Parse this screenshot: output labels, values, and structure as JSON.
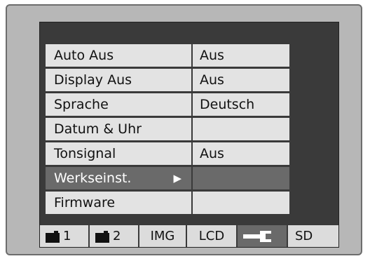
{
  "menu": {
    "items": [
      {
        "label": "Auto Aus",
        "value": "Aus"
      },
      {
        "label": "Display Aus",
        "value": "Aus"
      },
      {
        "label": "Sprache",
        "value": "Deutsch"
      },
      {
        "label": "Datum & Uhr",
        "value": ""
      },
      {
        "label": "Tonsignal",
        "value": "Aus"
      },
      {
        "label": "Werkseinst.",
        "value": "",
        "selected": true,
        "submenu_arrow": "▶"
      },
      {
        "label": "Firmware",
        "value": ""
      }
    ]
  },
  "tabs": [
    {
      "icon": "camera-icon",
      "label": "1"
    },
    {
      "icon": "camera-icon",
      "label": "2"
    },
    {
      "label": "IMG"
    },
    {
      "label": "LCD"
    },
    {
      "icon": "wrench-icon",
      "label": "",
      "active": true
    },
    {
      "label": "SD"
    }
  ],
  "colors": {
    "screen_background": "#3a3a3a",
    "menu_cell": "#e3e3e3",
    "selected_row": "#6a6a6a",
    "bezel": "#b7b7b7"
  }
}
